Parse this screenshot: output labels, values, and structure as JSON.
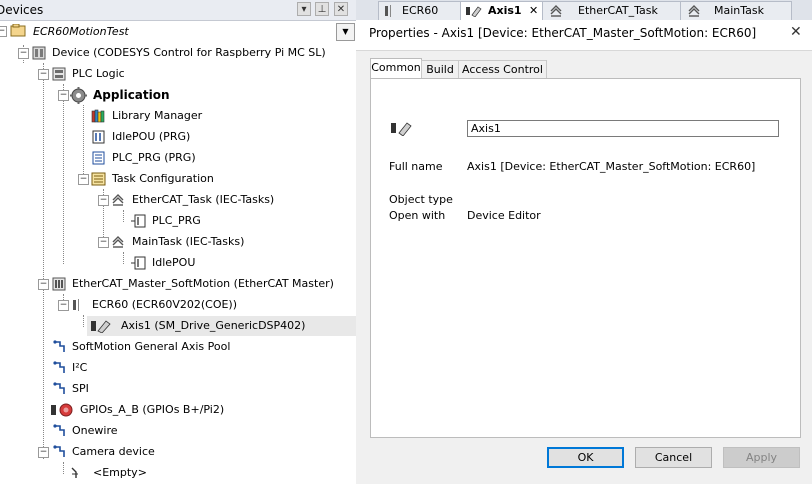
{
  "devices_pane": {
    "title": "Devices",
    "project_name": "ECR60MotionTest",
    "tree": [
      {
        "id": "device",
        "label": "Device (CODESYS Control for Raspberry Pi MC SL)",
        "icon": "device-icon"
      },
      {
        "id": "plc-logic",
        "label": "PLC Logic",
        "icon": "plc-logic-icon"
      },
      {
        "id": "application",
        "label": "Application",
        "icon": "gear-icon",
        "bold": true
      },
      {
        "id": "library-manager",
        "label": "Library Manager",
        "icon": "books-icon"
      },
      {
        "id": "idlepou",
        "label": "IdlePOU (PRG)",
        "icon": "pou-icon"
      },
      {
        "id": "plc-prg",
        "label": "PLC_PRG (PRG)",
        "icon": "document-icon"
      },
      {
        "id": "task-config",
        "label": "Task Configuration",
        "icon": "task-config-icon"
      },
      {
        "id": "ethercat-task",
        "label": "EtherCAT_Task (IEC-Tasks)",
        "icon": "task-icon"
      },
      {
        "id": "ethercat-task-plc-prg",
        "label": "PLC_PRG",
        "icon": "program-call-icon"
      },
      {
        "id": "maintask",
        "label": "MainTask (IEC-Tasks)",
        "icon": "task-icon"
      },
      {
        "id": "maintask-idlepou",
        "label": "IdlePOU",
        "icon": "program-call-icon"
      },
      {
        "id": "ethercat-master",
        "label": "EtherCAT_Master_SoftMotion (EtherCAT Master)",
        "icon": "ethercat-master-icon"
      },
      {
        "id": "ecr60",
        "label": "ECR60 (ECR60V202(COE))",
        "icon": "slave-icon"
      },
      {
        "id": "axis1",
        "label": "Axis1 (SM_Drive_GenericDSP402)",
        "icon": "axis-icon",
        "selected": true
      },
      {
        "id": "softmotion-pool",
        "label": "SoftMotion General Axis Pool",
        "icon": "connector-icon"
      },
      {
        "id": "i2c",
        "label": "I²C",
        "icon": "connector-icon"
      },
      {
        "id": "spi",
        "label": "SPI",
        "icon": "connector-icon"
      },
      {
        "id": "gpios",
        "label": "GPIOs_A_B (GPIOs B+/Pi2)",
        "icon": "gpio-icon"
      },
      {
        "id": "onewire",
        "label": "Onewire",
        "icon": "connector-icon"
      },
      {
        "id": "camera",
        "label": "Camera device",
        "icon": "connector-icon"
      },
      {
        "id": "empty",
        "label": "<Empty>",
        "icon": "empty-slot-icon"
      }
    ]
  },
  "editor_tabs": [
    {
      "label": "ECR60",
      "icon": "slave-icon"
    },
    {
      "label": "Axis1",
      "icon": "axis-icon",
      "active": true
    },
    {
      "label": "EtherCAT_Task",
      "icon": "task-icon"
    },
    {
      "label": "MainTask",
      "icon": "task-icon"
    }
  ],
  "properties": {
    "title": "Properties - Axis1 [Device: EtherCAT_Master_SoftMotion: ECR60]",
    "tabs": [
      "Common",
      "Build",
      "Access Control"
    ],
    "active_tab": "Common",
    "name_value": "Axis1",
    "full_name_label": "Full name",
    "full_name_value": "Axis1 [Device: EtherCAT_Master_SoftMotion: ECR60]",
    "object_type_label": "Object type",
    "open_with_label": "Open with",
    "open_with_value": "Device Editor",
    "ok_label": "OK",
    "cancel_label": "Cancel",
    "apply_label": "Apply"
  },
  "colors": {
    "selection": "#e8e8e8",
    "primary_button_border": "#0078d7",
    "title_bar": "#e9ecf2"
  }
}
